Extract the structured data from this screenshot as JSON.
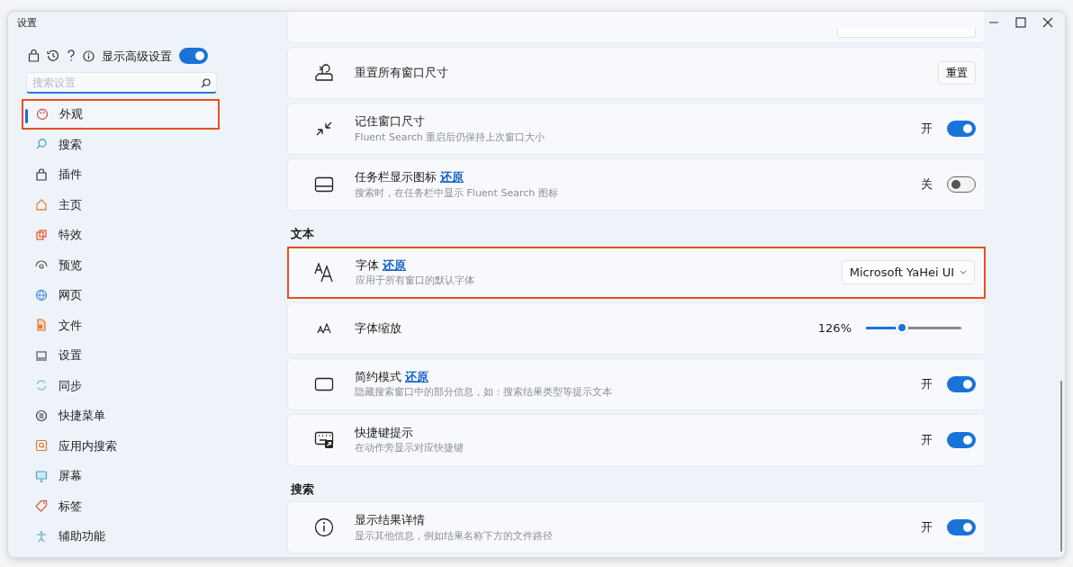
{
  "window": {
    "title": "设置"
  },
  "sidebar": {
    "advanced": {
      "label": "显示高级设置",
      "on": true
    },
    "search": {
      "placeholder": "搜索设置"
    },
    "items": [
      {
        "label": "外观",
        "selected": true,
        "highlighted": true
      },
      {
        "label": "搜索",
        "selected": false,
        "highlighted": false
      },
      {
        "label": "插件",
        "selected": false,
        "highlighted": false
      },
      {
        "label": "主页",
        "selected": false,
        "highlighted": false
      },
      {
        "label": "特效",
        "selected": false,
        "highlighted": false
      },
      {
        "label": "预览",
        "selected": false,
        "highlighted": false
      },
      {
        "label": "网页",
        "selected": false,
        "highlighted": false
      },
      {
        "label": "文件",
        "selected": false,
        "highlighted": false
      },
      {
        "label": "设置",
        "selected": false,
        "highlighted": false
      },
      {
        "label": "同步",
        "selected": false,
        "highlighted": false
      },
      {
        "label": "快捷菜单",
        "selected": false,
        "highlighted": false
      },
      {
        "label": "应用内搜索",
        "selected": false,
        "highlighted": false
      },
      {
        "label": "屏幕",
        "selected": false,
        "highlighted": false
      },
      {
        "label": "标签",
        "selected": false,
        "highlighted": false
      },
      {
        "label": "辅助功能",
        "selected": false,
        "highlighted": false
      }
    ]
  },
  "sections": [
    {
      "rows": [
        {
          "kind": "button",
          "title": "重置所有窗口尺寸",
          "button": "重置",
          "highlighted": false
        },
        {
          "kind": "toggle",
          "title": "记住窗口尺寸",
          "subtitle": "Fluent Search 重启后仍保持上次窗口大小",
          "state_label": "开",
          "on": true,
          "highlighted": false
        },
        {
          "kind": "toggle",
          "title": "任务栏显示图标",
          "reset": "还原",
          "subtitle": "搜索时，在任务栏中显示 Fluent Search 图标",
          "state_label": "关",
          "on": false,
          "highlighted": false
        }
      ]
    },
    {
      "title": "文本",
      "rows": [
        {
          "kind": "dropdown",
          "title": "字体",
          "reset": "还原",
          "subtitle": "应用于所有窗口的默认字体",
          "value": "Microsoft YaHei UI",
          "highlighted": true
        },
        {
          "kind": "slider",
          "title": "字体缩放",
          "reading": "126%",
          "level": 0.38,
          "highlighted": false
        },
        {
          "kind": "toggle",
          "title": "简约模式",
          "reset": "还原",
          "subtitle": "隐藏搜索窗口中的部分信息，如：搜索结果类型等提示文本",
          "state_label": "开",
          "on": true,
          "highlighted": false
        },
        {
          "kind": "toggle",
          "title": "快捷键提示",
          "subtitle": "在动作旁显示对应快捷键",
          "state_label": "开",
          "on": true,
          "highlighted": false
        }
      ]
    },
    {
      "title": "搜索",
      "rows": [
        {
          "kind": "toggle",
          "title": "显示结果详情",
          "subtitle": "显示其他信息，例如结果名称下方的文件路径",
          "state_label": "开",
          "on": true,
          "highlighted": false
        }
      ]
    }
  ]
}
